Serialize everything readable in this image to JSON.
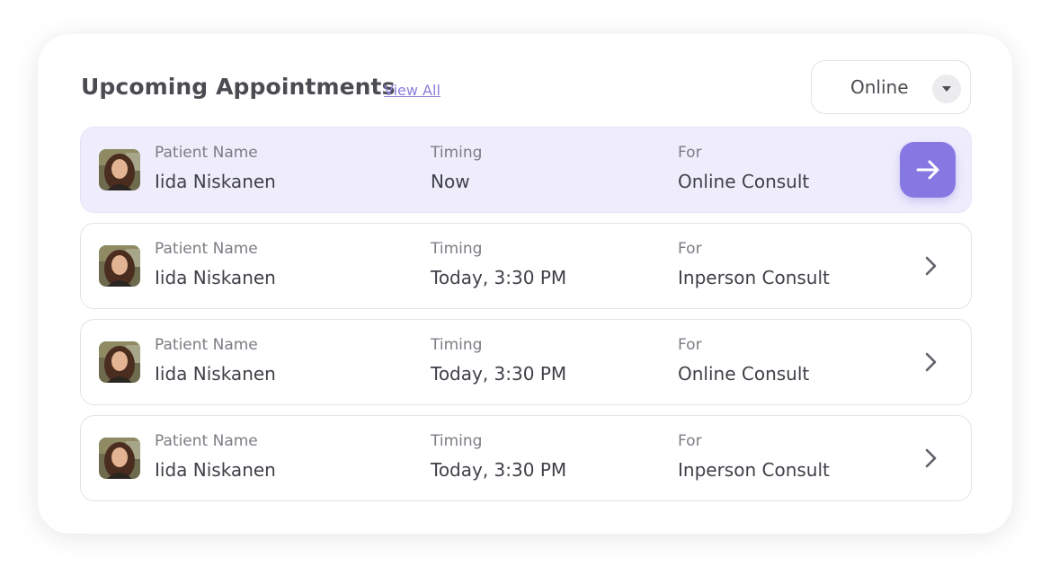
{
  "header": {
    "title": "Upcoming Appointments",
    "view_all_label": "View All",
    "filter": {
      "selected": "Online"
    }
  },
  "columns": {
    "patient_label": "Patient Name",
    "timing_label": "Timing",
    "for_label": "For"
  },
  "appointments": [
    {
      "patient": "Iida Niskanen",
      "timing": "Now",
      "for": "Online Consult",
      "active": true,
      "action_icon": "arrow-right-icon"
    },
    {
      "patient": "Iida Niskanen",
      "timing": "Today, 3:30 PM",
      "for": "Inperson Consult",
      "active": false,
      "action_icon": "chevron-right-icon"
    },
    {
      "patient": "Iida Niskanen",
      "timing": "Today, 3:30 PM",
      "for": "Online Consult",
      "active": false,
      "action_icon": "chevron-right-icon"
    },
    {
      "patient": "Iida Niskanen",
      "timing": "Today, 3:30 PM",
      "for": "Inperson Consult",
      "active": false,
      "action_icon": "chevron-right-icon"
    }
  ],
  "colors": {
    "accent": "#8678e3",
    "active_row_bg": "#efedfc",
    "title_text": "#4b4b52",
    "link": "#8a7fdc"
  }
}
